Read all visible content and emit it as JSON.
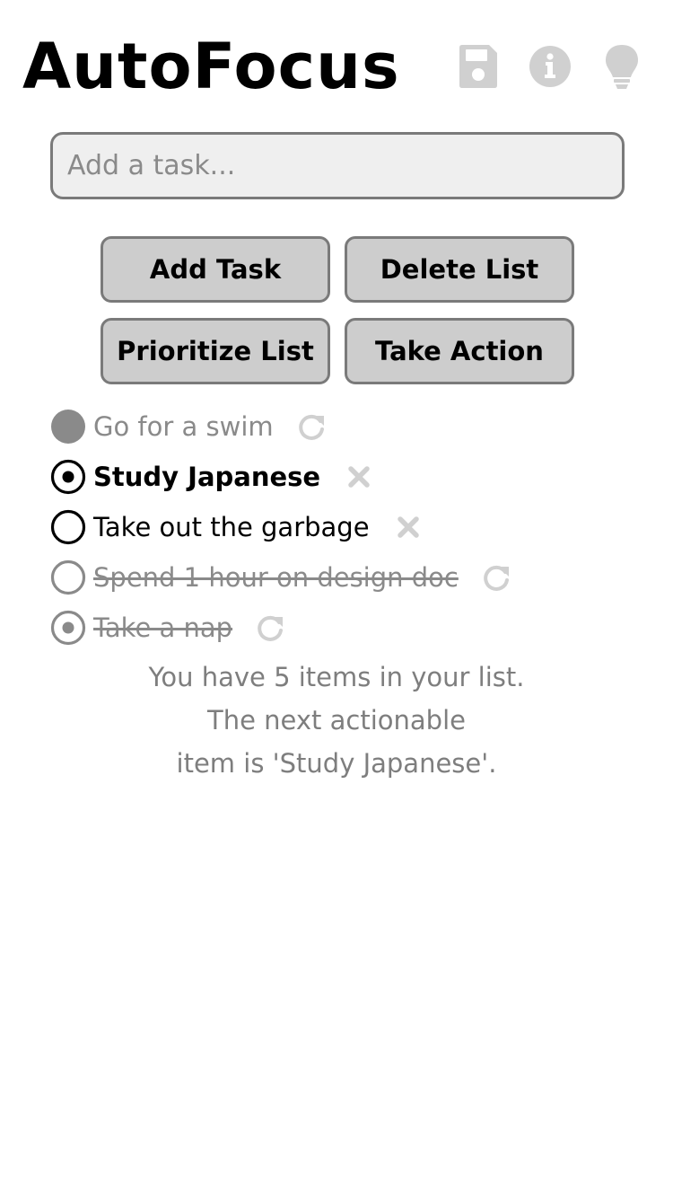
{
  "header": {
    "title": "AutoFocus",
    "icons": [
      "save-icon",
      "info-icon",
      "lightbulb-icon"
    ]
  },
  "input": {
    "placeholder": "Add a task...",
    "value": ""
  },
  "buttons": {
    "add_task": "Add Task",
    "delete_list": "Delete List",
    "prioritize_list": "Prioritize List",
    "take_action": "Take Action"
  },
  "tasks": [
    {
      "label": "Go for a swim",
      "state": "done",
      "marker": "filled",
      "action_icon": "redo-icon"
    },
    {
      "label": "Study Japanese",
      "state": "active",
      "marker": "dotted",
      "action_icon": "delete-icon"
    },
    {
      "label": "Take out the garbage",
      "state": "open",
      "marker": "empty",
      "action_icon": "delete-icon"
    },
    {
      "label": "Spend 1 hour on design doc",
      "state": "struck",
      "marker": "empty",
      "action_icon": "redo-icon"
    },
    {
      "label": "Take a nap",
      "state": "struck",
      "marker": "dotted",
      "action_icon": "redo-icon"
    }
  ],
  "status": {
    "line1": "You have 5 items in your list.",
    "line2": "The next actionable",
    "line3": "item is 'Study Japanese'."
  },
  "colors": {
    "text": "#000000",
    "muted": "#8a8a8a",
    "icon_gray": "#d0d0d0",
    "button_bg": "#cdcdcd",
    "button_border": "#7a7a7a",
    "input_bg": "#efefef"
  }
}
